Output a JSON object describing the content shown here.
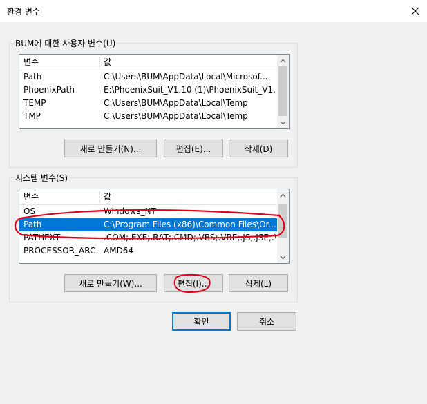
{
  "window": {
    "title": "환경 변수"
  },
  "user_vars": {
    "group_label": "BUM에 대한 사용자 변수(U)",
    "columns": [
      "변수",
      "값"
    ],
    "rows": [
      {
        "name": "Path",
        "value": "C:\\Users\\BUM\\AppData\\Local\\Microsof..."
      },
      {
        "name": "PhoenixPath",
        "value": "E:\\PhoenixSuit_V1.10 (1)\\PhoenixSuit_V1...."
      },
      {
        "name": "TEMP",
        "value": "C:\\Users\\BUM\\AppData\\Local\\Temp"
      },
      {
        "name": "TMP",
        "value": "C:\\Users\\BUM\\AppData\\Local\\Temp"
      }
    ],
    "buttons": {
      "new": "새로 만들기(N)...",
      "edit": "편집(E)...",
      "delete": "삭제(D)"
    }
  },
  "system_vars": {
    "group_label": "시스템 변수(S)",
    "columns": [
      "변수",
      "값"
    ],
    "rows": [
      {
        "name": "OS",
        "value": "Windows_NT"
      },
      {
        "name": "Path",
        "value": "C:\\Program Files (x86)\\Common Files\\Or..."
      },
      {
        "name": "PATHEXT",
        "value": ".COM;.EXE;.BAT;.CMD;.VBS;.VBE;.JS;.JSE;.W..."
      },
      {
        "name": "PROCESSOR_ARC...",
        "value": "AMD64"
      }
    ],
    "selected_row": "Path",
    "buttons": {
      "new": "새로 만들기(W)...",
      "edit": "편집(I)...",
      "delete": "삭제(L)"
    }
  },
  "footer": {
    "ok": "확인",
    "cancel": "취소"
  },
  "colors": {
    "selection": "#0078d7",
    "annotation": "#e0001b"
  }
}
